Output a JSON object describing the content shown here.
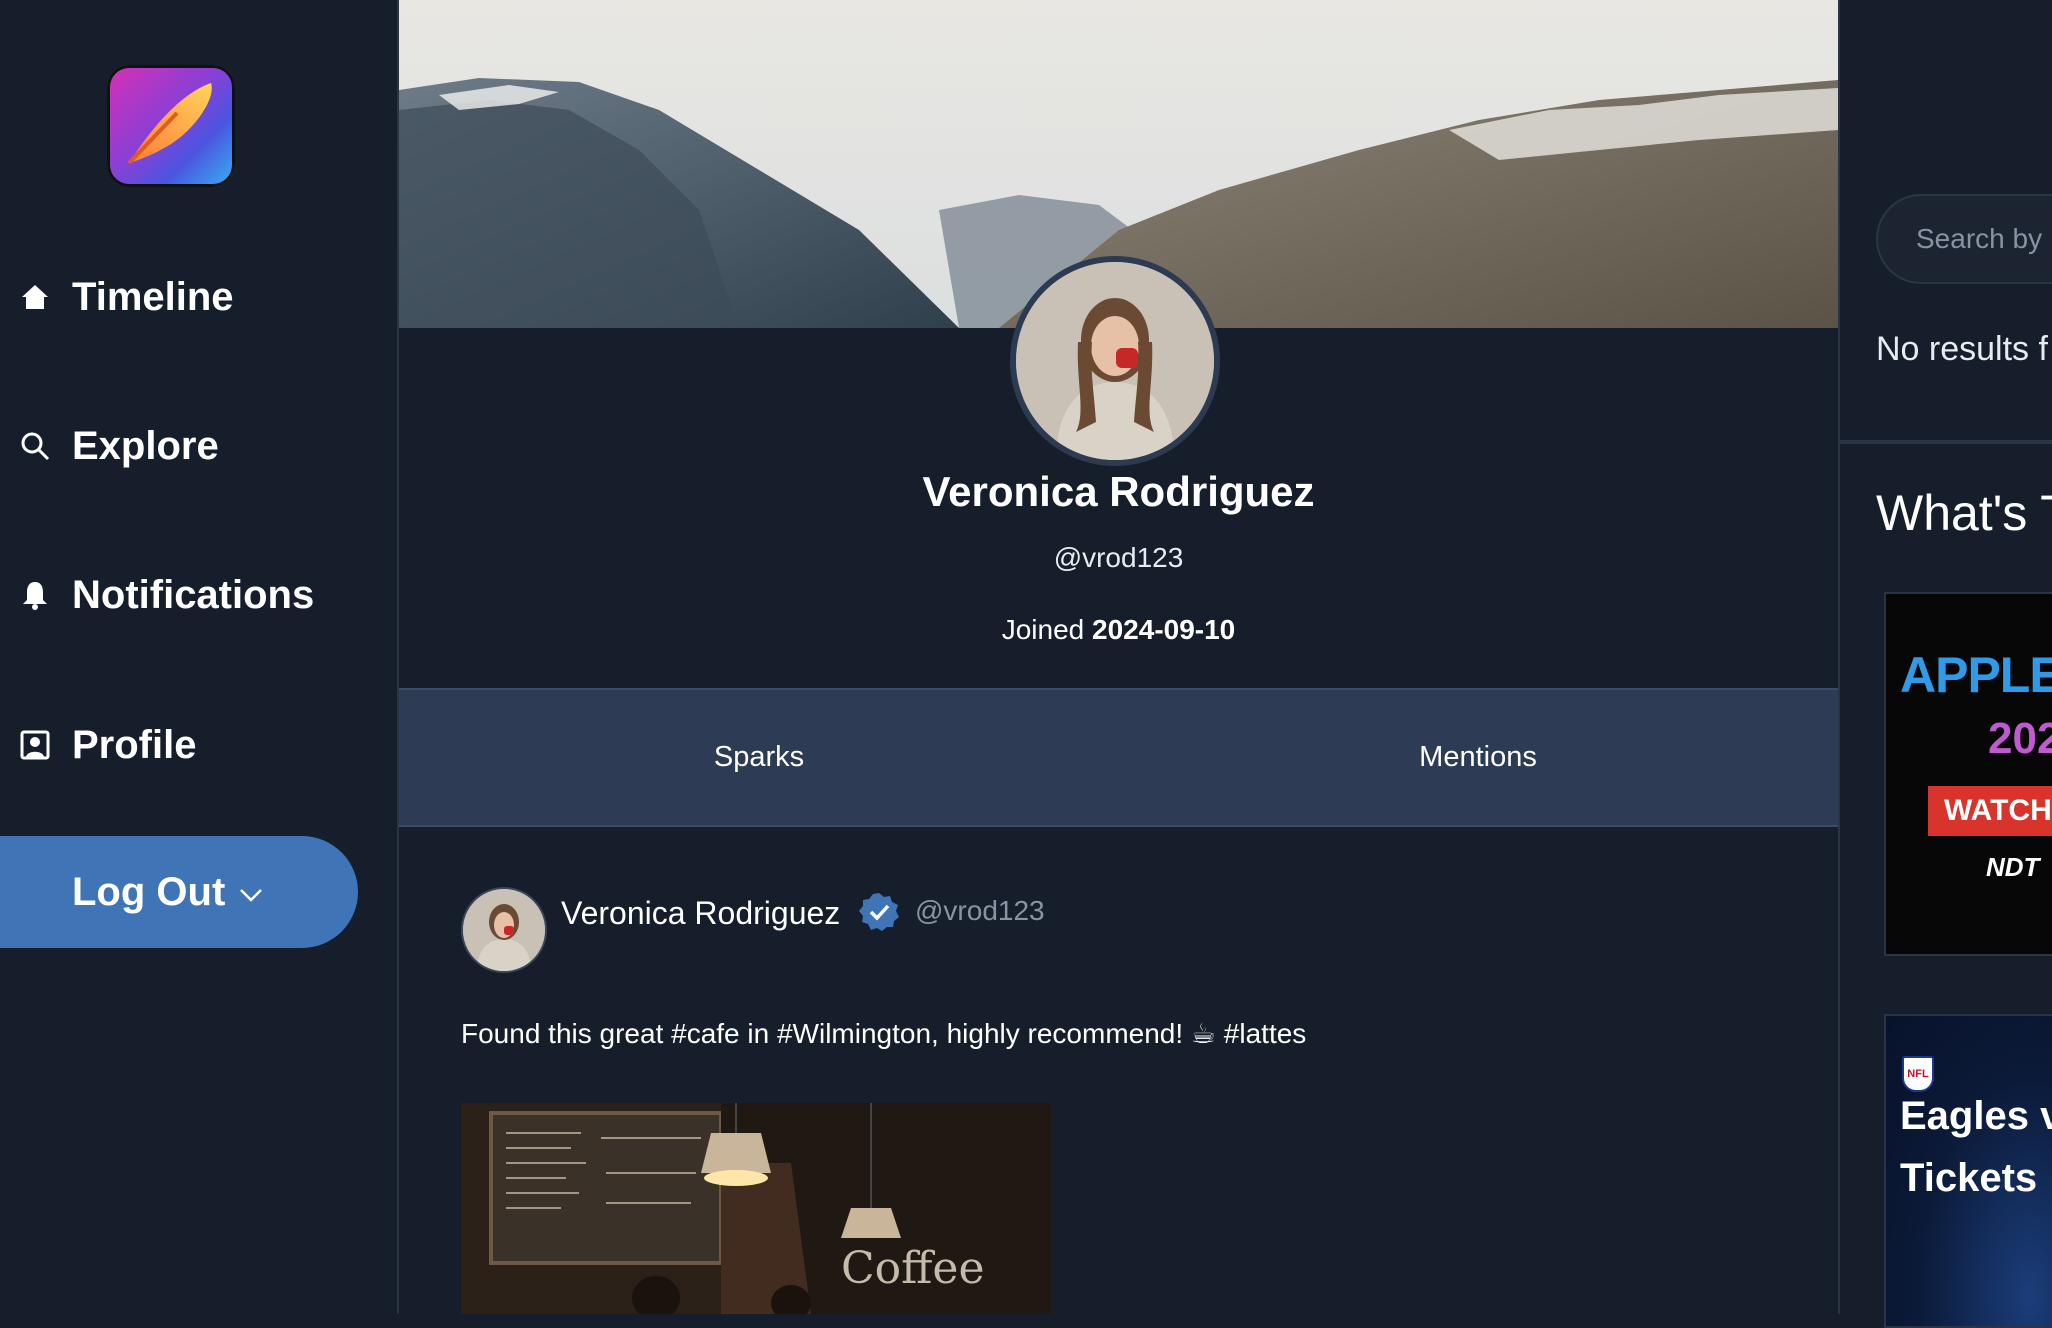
{
  "sidebar": {
    "items": [
      {
        "label": "Timeline",
        "icon": "home-icon"
      },
      {
        "label": "Explore",
        "icon": "search-icon"
      },
      {
        "label": "Notifications",
        "icon": "bell-icon"
      },
      {
        "label": "Profile",
        "icon": "profile-icon"
      }
    ],
    "logout_label": "Log Out"
  },
  "profile": {
    "name": "Veronica Rodriguez",
    "handle": "@vrod123",
    "joined_prefix": "Joined",
    "joined_date": "2024-09-10"
  },
  "tabs": [
    {
      "label": "Sparks"
    },
    {
      "label": "Mentions"
    }
  ],
  "post": {
    "author_name": "Veronica Rodriguez",
    "author_handle": "@vrod123",
    "verified": true,
    "text": "Found this great #cafe in #Wilmington, highly recommend! ☕ #lattes"
  },
  "right": {
    "search_placeholder": "Search by",
    "no_results": "No results f",
    "trending_title": "What's T",
    "ads": [
      {
        "lines": [
          "APPLE",
          "202",
          "WATCH",
          "NDT"
        ]
      },
      {
        "badge": "NFL",
        "lines": [
          "Eagles v",
          "Tickets"
        ]
      }
    ]
  },
  "colors": {
    "background": "#171e2b",
    "accent": "#3f74b6",
    "tabs_bg": "#2e3b54",
    "verified": "#3f74b6"
  }
}
